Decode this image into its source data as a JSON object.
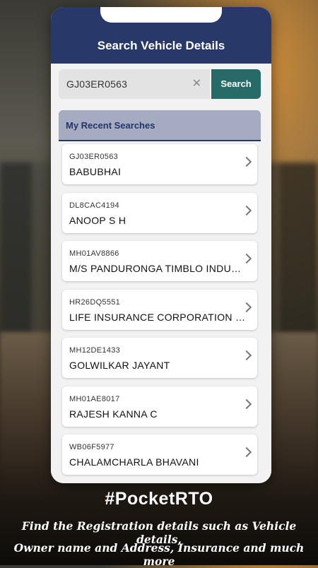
{
  "header": {
    "title": "Search Vehicle Details"
  },
  "search": {
    "value": "GJ03ER0563",
    "button_label": "Search"
  },
  "recent": {
    "title": "My Recent Searches",
    "items": [
      {
        "reg": "GJ03ER0563",
        "name": "BABUBHAI"
      },
      {
        "reg": "DL8CAC4194",
        "name": "ANOOP S H"
      },
      {
        "reg": "MH01AV8866",
        "name": "M/S PANDURONGA TIMBLO INDUSTRIES"
      },
      {
        "reg": "HR26DQ5551",
        "name": "LIFE INSURANCE CORPORATION OF INDIA"
      },
      {
        "reg": "MH12DE1433",
        "name": "GOLWILKAR JAYANT"
      },
      {
        "reg": "MH01AE8017",
        "name": "RAJESH KANNA C"
      },
      {
        "reg": "WB06F5977",
        "name": "CHALAMCHARLA BHAVANI"
      }
    ]
  },
  "promo": {
    "hashtag": "#PocketRTO",
    "line1": "Find the Registration details such as Vehicle details,",
    "line2": "Owner name and Address, Insurance and much more"
  },
  "colors": {
    "header": "#283868",
    "search_button": "#266b68",
    "recent_header": "#a5abc0"
  },
  "icons": {
    "clear": "close-icon",
    "row_arrow": "chevron-right-icon"
  }
}
